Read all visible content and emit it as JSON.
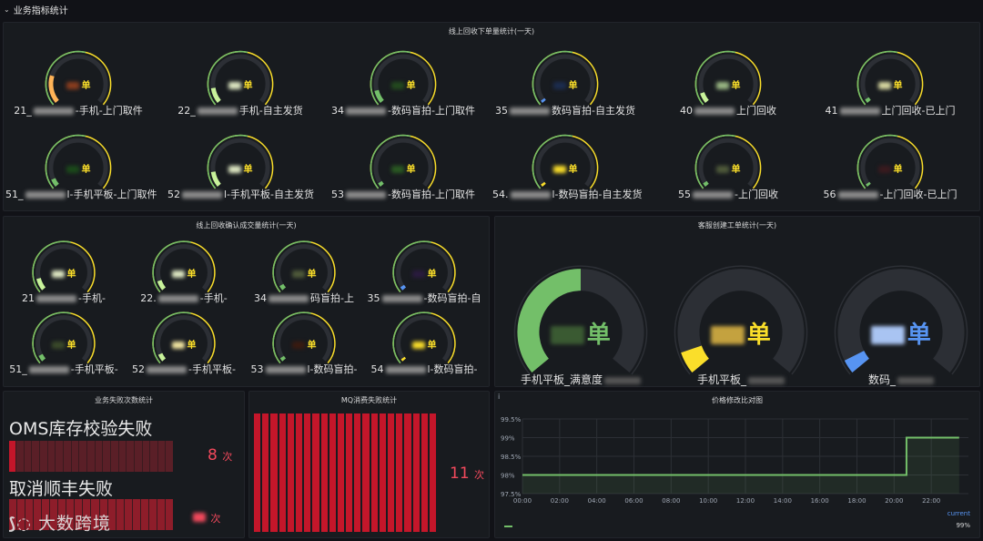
{
  "row": {
    "title": "业务指标统计",
    "chevron": "chevron-down-icon"
  },
  "colors": {
    "green": "#73bf69",
    "yellow": "#fade2a",
    "orange": "#ffb357",
    "red": "#f2495c",
    "blue": "#5794f2",
    "dark_red": "#c4162a"
  },
  "panel_orders": {
    "title": "线上回收下单量统计(一天)",
    "gauges": [
      {
        "label_pre": "21_",
        "label_post": "-手机-上门取件",
        "unit": "单"
      },
      {
        "label_pre": "22_",
        "label_post": "手机-自主发货",
        "unit": "单"
      },
      {
        "label_pre": "34",
        "label_post": "-数码盲拍-上门取件",
        "unit": "单"
      },
      {
        "label_pre": "35",
        "label_post": "数码盲拍-自主发货",
        "unit": "单"
      },
      {
        "label_pre": "40",
        "label_post": "上门回收",
        "unit": "单"
      },
      {
        "label_pre": "41",
        "label_post": "上门回收-已上门",
        "unit": "单"
      },
      {
        "label_pre": "51_",
        "label_post": "l-手机平板-上门取件",
        "unit": "单"
      },
      {
        "label_pre": "52",
        "label_post": "l-手机平板-自主发货",
        "unit": "单"
      },
      {
        "label_pre": "53",
        "label_post": "-数码盲拍-上门取件",
        "unit": "单"
      },
      {
        "label_pre": "54.",
        "label_post": "l-数码盲拍-自主发货",
        "unit": "单"
      },
      {
        "label_pre": "55",
        "label_post": "-上门回收",
        "unit": "单"
      },
      {
        "label_pre": "56",
        "label_post": "-上门回收-已上门",
        "unit": "单"
      }
    ]
  },
  "panel_confirm": {
    "title": "线上回收确认成交量统计(一天)",
    "gauges": [
      {
        "label_pre": "21",
        "label_post": "-手机-",
        "unit": "单"
      },
      {
        "label_pre": "22.",
        "label_post": "-手机-",
        "unit": "单"
      },
      {
        "label_pre": "34",
        "label_post": "码盲拍-上",
        "unit": "单"
      },
      {
        "label_pre": "35",
        "label_post": "-数码盲拍-自",
        "unit": "单"
      },
      {
        "label_pre": "51_",
        "label_post": "-手机平板-",
        "unit": "单"
      },
      {
        "label_pre": "52",
        "label_post": "-手机平板-",
        "unit": "单"
      },
      {
        "label_pre": "53",
        "label_post": "l-数码盲拍-",
        "unit": "单"
      },
      {
        "label_pre": "54",
        "label_post": "l-数码盲拍-",
        "unit": "单"
      }
    ]
  },
  "panel_tickets": {
    "title": "客服创建工单统计(一天)",
    "gauges": [
      {
        "label": "手机平板_满意度",
        "unit": "单"
      },
      {
        "label": "手机平板_",
        "unit": "单"
      },
      {
        "label": "数码_",
        "unit": "单"
      }
    ]
  },
  "panel_failures": {
    "title": "业务失败次数统计",
    "items": [
      {
        "name": "OMS库存校验失败",
        "value": "8",
        "unit": "次"
      },
      {
        "name": "取消顺丰失败",
        "value": "",
        "unit": "次"
      }
    ]
  },
  "panel_mq": {
    "title": "MQ消费失败统计",
    "value": "11",
    "unit": "次"
  },
  "panel_price": {
    "title": "价格修改比对图",
    "info_icon": "i",
    "y_ticks": [
      "99.5%",
      "99%",
      "98.5%",
      "98%",
      "97.5%"
    ],
    "x_ticks": [
      "00:00",
      "02:00",
      "04:00",
      "06:00",
      "08:00",
      "10:00",
      "12:00",
      "14:00",
      "16:00",
      "18:00",
      "20:00",
      "22:00"
    ],
    "legend_header": "current",
    "legend_value": "99%"
  },
  "chart_data": {
    "type": "line",
    "title": "价格修改比对图",
    "x": [
      "00:00",
      "02:00",
      "04:00",
      "06:00",
      "08:00",
      "10:00",
      "12:00",
      "14:00",
      "16:00",
      "18:00",
      "20:00",
      "20:40",
      "22:00",
      "23:30"
    ],
    "series": [
      {
        "values": [
          98,
          98,
          98,
          98,
          98,
          98,
          98,
          98,
          98,
          98,
          98,
          99,
          99,
          99
        ]
      }
    ],
    "ylim": [
      97.5,
      99.5
    ],
    "y_unit": "%",
    "grid": true
  },
  "watermark": "大数跨境"
}
